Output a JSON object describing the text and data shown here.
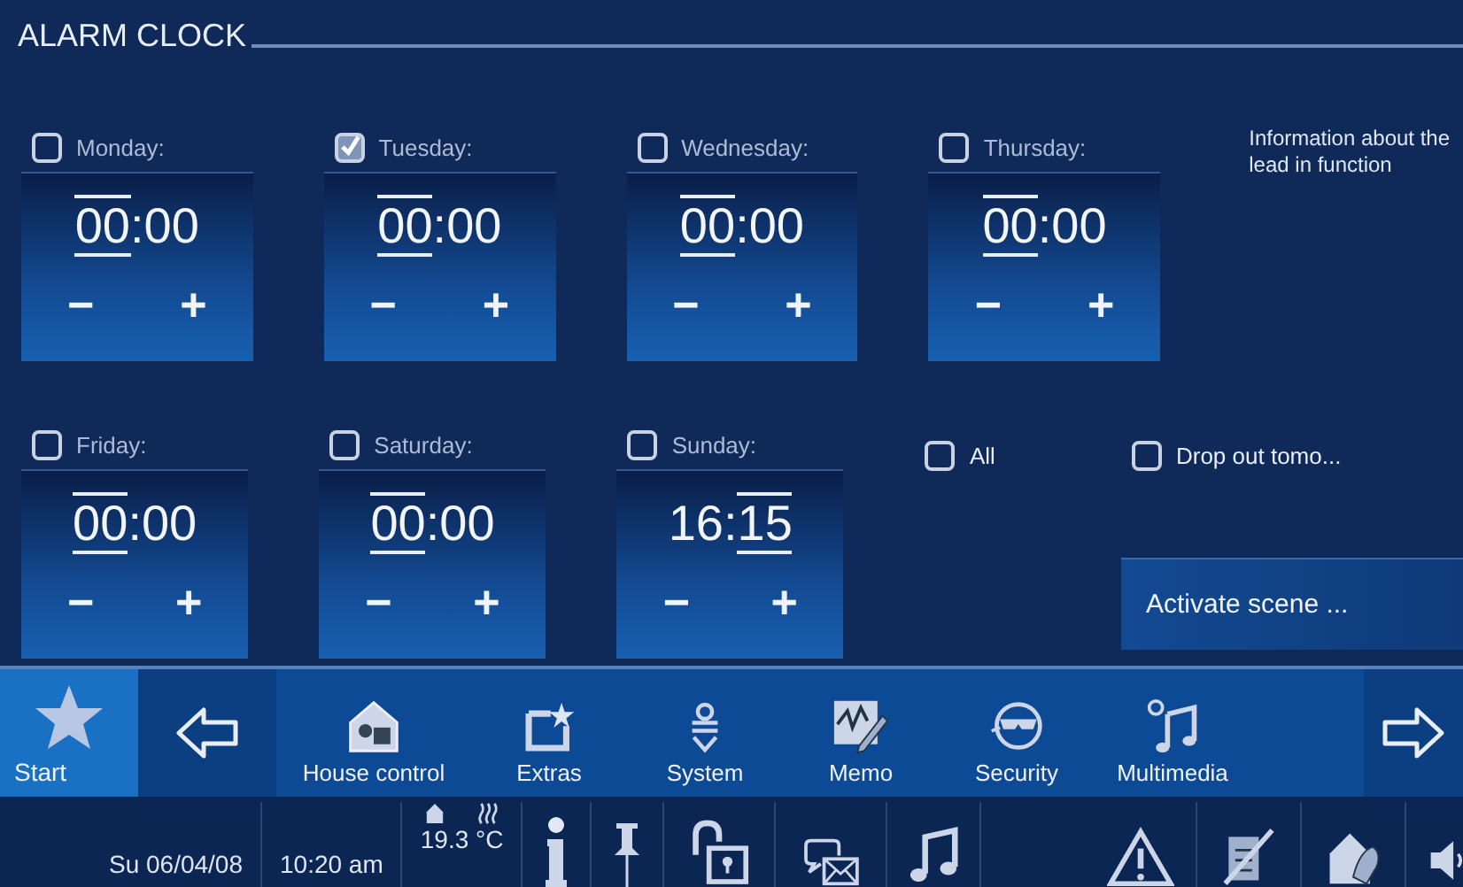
{
  "title": "ALARM CLOCK",
  "days": [
    {
      "label": "Monday:",
      "checked": false,
      "hours": "00",
      "separator": ":",
      "minutes": "00",
      "hours_selected": true,
      "minutes_selected": false,
      "minus": "−",
      "plus": "+"
    },
    {
      "label": "Tuesday:",
      "checked": true,
      "hours": "00",
      "separator": ":",
      "minutes": "00",
      "hours_selected": true,
      "minutes_selected": false,
      "minus": "−",
      "plus": "+"
    },
    {
      "label": "Wednesday:",
      "checked": false,
      "hours": "00",
      "separator": ":",
      "minutes": "00",
      "hours_selected": true,
      "minutes_selected": false,
      "minus": "−",
      "plus": "+"
    },
    {
      "label": "Thursday:",
      "checked": false,
      "hours": "00",
      "separator": ":",
      "minutes": "00",
      "hours_selected": true,
      "minutes_selected": false,
      "minus": "−",
      "plus": "+"
    },
    {
      "label": "Friday:",
      "checked": false,
      "hours": "00",
      "separator": ":",
      "minutes": "00",
      "hours_selected": true,
      "minutes_selected": false,
      "minus": "−",
      "plus": "+"
    },
    {
      "label": "Saturday:",
      "checked": false,
      "hours": "00",
      "separator": ":",
      "minutes": "00",
      "hours_selected": true,
      "minutes_selected": false,
      "minus": "−",
      "plus": "+"
    },
    {
      "label": "Sunday:",
      "checked": false,
      "hours": "16",
      "separator": ":",
      "minutes": "15",
      "hours_selected": false,
      "minutes_selected": true,
      "minus": "−",
      "plus": "+"
    }
  ],
  "info": "Information about the lead in function",
  "all": {
    "label": "All",
    "checked": false
  },
  "drop_out": {
    "label": "Drop out tomo...",
    "checked": false
  },
  "activate_button": "Activate scene ...",
  "nav": [
    {
      "kind": "star",
      "label": "Start",
      "selected": true
    },
    {
      "kind": "back"
    },
    {
      "kind": "house",
      "label": "House control",
      "selected": false
    },
    {
      "kind": "extras",
      "label": "Extras",
      "selected": false
    },
    {
      "kind": "system",
      "label": "System",
      "selected": false
    },
    {
      "kind": "memo",
      "label": "Memo",
      "selected": false
    },
    {
      "kind": "security",
      "label": "Security",
      "selected": false
    },
    {
      "kind": "music",
      "label": "Multimedia",
      "selected": false
    },
    {
      "kind": "forward"
    }
  ],
  "status": {
    "date": "Su 06/04/08",
    "time": "10:20 am",
    "temperature": "19.3",
    "unit": "°C"
  }
}
